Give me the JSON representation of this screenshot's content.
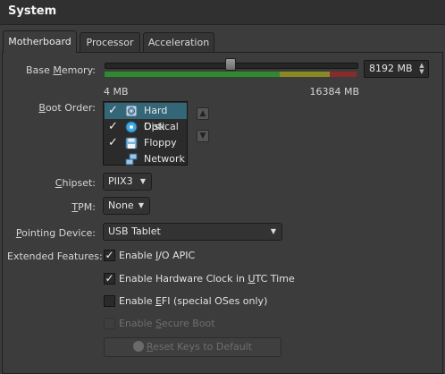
{
  "section_title": "System",
  "tabs": [
    {
      "label": "Motherboard",
      "active": true
    },
    {
      "label": "Processor",
      "active": false
    },
    {
      "label": "Acceleration",
      "active": false
    }
  ],
  "base_memory": {
    "label_pre": "Base ",
    "label_u": "M",
    "label_post": "emory:",
    "value": "8192 MB",
    "slider_fraction": 0.5,
    "min_label": "4 MB",
    "max_label": "16384 MB"
  },
  "boot_order": {
    "label_u": "B",
    "label_post": "oot Order:",
    "items": [
      {
        "label": "Hard Disk",
        "checked": true,
        "icon": "hard-disk-icon"
      },
      {
        "label": "Optical",
        "checked": true,
        "icon": "optical-disc-icon"
      },
      {
        "label": "Floppy",
        "checked": true,
        "icon": "floppy-icon"
      },
      {
        "label": "Network",
        "checked": false,
        "icon": "network-icon"
      }
    ]
  },
  "chipset": {
    "label_u": "C",
    "label_post": "hipset:",
    "value": "PIIX3"
  },
  "tpm": {
    "label_u": "T",
    "label_post": "PM:",
    "value": "None"
  },
  "pointing_device": {
    "label_u": "P",
    "label_post": "ointing Device:",
    "value": "USB Tablet"
  },
  "extended_features": {
    "label": "Extended Features:",
    "options": [
      {
        "pre": "Enable ",
        "u": "I",
        "post": "/O APIC",
        "checked": true,
        "enabled": true
      },
      {
        "pre": "Enable Hardware Clock in ",
        "u": "U",
        "post": "TC Time",
        "checked": true,
        "enabled": true
      },
      {
        "pre": "Enable ",
        "u": "E",
        "post": "FI (special OSes only)",
        "checked": false,
        "enabled": true
      },
      {
        "pre": "Enable ",
        "u": "S",
        "post": "ecure Boot",
        "checked": false,
        "enabled": false
      }
    ]
  },
  "reset_keys": {
    "pre": "",
    "u": "R",
    "post": "eset Keys to Default",
    "enabled": false
  },
  "colors": {
    "selection": "#336778",
    "green": "#2f8a2f",
    "yellow": "#8a8a24",
    "red": "#8a2b2b"
  }
}
